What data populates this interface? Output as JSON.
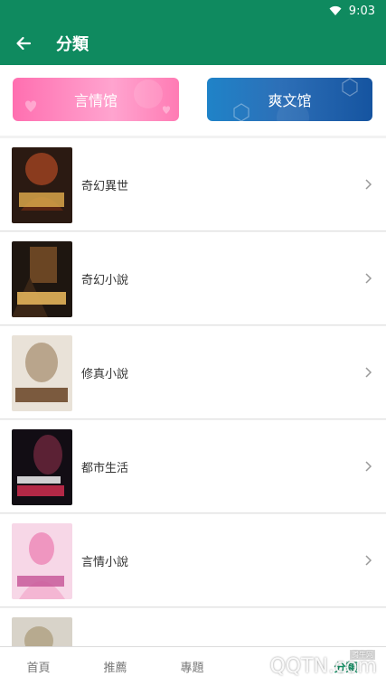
{
  "status_bar": {
    "time": "9:03"
  },
  "app_bar": {
    "title": "分類"
  },
  "halls": {
    "love_label": "言情馆",
    "cool_label": "爽文馆"
  },
  "categories": [
    {
      "label": "奇幻異世",
      "cover_palette": [
        "#2b1a12",
        "#8a3b1e",
        "#d9a64a"
      ]
    },
    {
      "label": "奇幻小說",
      "cover_palette": [
        "#1e1610",
        "#6a4523",
        "#e2b35a"
      ]
    },
    {
      "label": "修真小說",
      "cover_palette": [
        "#e9e2d8",
        "#b9a58c",
        "#6f4b2d"
      ]
    },
    {
      "label": "都市生活",
      "cover_palette": [
        "#120d14",
        "#5b2134",
        "#f2f2f2"
      ]
    },
    {
      "label": "言情小說",
      "cover_palette": [
        "#f7d7e7",
        "#ef96c0",
        "#c85b9a"
      ]
    },
    {
      "label": "",
      "cover_palette": [
        "#d8d3c9",
        "#b7aa8f",
        "#7b6a50"
      ]
    }
  ],
  "bottom_nav": {
    "items": [
      {
        "label": "首頁"
      },
      {
        "label": "推薦"
      },
      {
        "label": "專題"
      },
      {
        "label": ""
      },
      {
        "label": "分類"
      }
    ]
  },
  "watermark": {
    "main": "QQTN.com",
    "corner": "腾牛网"
  }
}
